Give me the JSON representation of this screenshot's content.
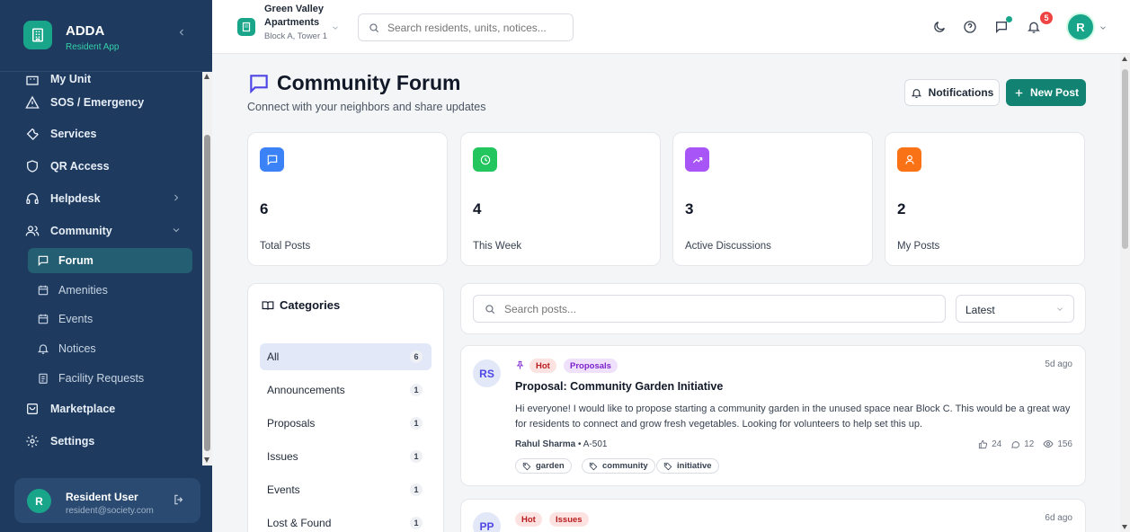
{
  "brand": {
    "title": "ADDA",
    "subtitle": "Resident App"
  },
  "sidebar": {
    "items": [
      {
        "label": "My Unit",
        "icon": "building-icon"
      },
      {
        "label": "SOS / Emergency",
        "icon": "alert-triangle-icon"
      },
      {
        "label": "Services",
        "icon": "wrench-icon"
      },
      {
        "label": "QR Access",
        "icon": "shield-icon"
      },
      {
        "label": "Helpdesk",
        "icon": "headphones-icon"
      },
      {
        "label": "Community",
        "icon": "users-icon"
      },
      {
        "label": "Marketplace",
        "icon": "shopping-bag-icon"
      },
      {
        "label": "Settings",
        "icon": "gear-icon"
      }
    ],
    "community_sub": [
      {
        "label": "Forum",
        "icon": "message-square-icon"
      },
      {
        "label": "Amenities",
        "icon": "calendar-icon"
      },
      {
        "label": "Events",
        "icon": "calendar-icon"
      },
      {
        "label": "Notices",
        "icon": "bell-icon"
      },
      {
        "label": "Facility Requests",
        "icon": "clipboard-icon"
      }
    ],
    "user": {
      "initial": "R",
      "name": "Resident User",
      "email": "resident@society.com"
    }
  },
  "topbar": {
    "project_top": "Green Valley",
    "project_name": "Apartments",
    "project_sub": "Block A, Tower 1",
    "search_placeholder": "Search residents, units, notices...",
    "notification_count": "5",
    "avatar_initial": "R"
  },
  "page": {
    "title": "Community Forum",
    "subtitle": "Connect with your neighbors and share updates",
    "notifications_button": "Notifications",
    "new_post_button": "New Post"
  },
  "stats": [
    {
      "value": "6",
      "label": "Total Posts",
      "color": "#3b82f6",
      "icon": "message-square-icon"
    },
    {
      "value": "4",
      "label": "This Week",
      "color": "#22c55e",
      "icon": "clock-icon"
    },
    {
      "value": "3",
      "label": "Active Discussions",
      "color": "#a855f7",
      "icon": "trending-up-icon"
    },
    {
      "value": "2",
      "label": "My Posts",
      "color": "#f97316",
      "icon": "user-icon"
    }
  ],
  "categories": {
    "title": "Categories",
    "items": [
      {
        "name": "All",
        "count": "6"
      },
      {
        "name": "Announcements",
        "count": "1"
      },
      {
        "name": "Proposals",
        "count": "1"
      },
      {
        "name": "Issues",
        "count": "1"
      },
      {
        "name": "Events",
        "count": "1"
      },
      {
        "name": "Lost & Found",
        "count": "1"
      }
    ]
  },
  "filters": {
    "search_placeholder": "Search posts...",
    "sort_value": "Latest"
  },
  "posts": [
    {
      "initials": "RS",
      "badges": [
        "Hot",
        "Proposals"
      ],
      "time": "5d ago",
      "title": "Proposal: Community Garden Initiative",
      "body": "Hi everyone! I would like to propose starting a community garden in the unused space near Block C. This would be a great way for residents to connect and grow fresh vegetables. Looking for volunteers to help set this up.",
      "author": "Rahul Sharma",
      "unit": "A-501",
      "likes": "24",
      "comments": "12",
      "views": "156",
      "tags": [
        "garden",
        "community",
        "initiative"
      ]
    },
    {
      "initials": "PP",
      "badges": [
        "Hot",
        "Issues"
      ],
      "time": "6d ago"
    }
  ],
  "colors": {
    "sidebar_bg": "#1e3a5f",
    "accent": "#128372",
    "brand": "#18a58a"
  }
}
